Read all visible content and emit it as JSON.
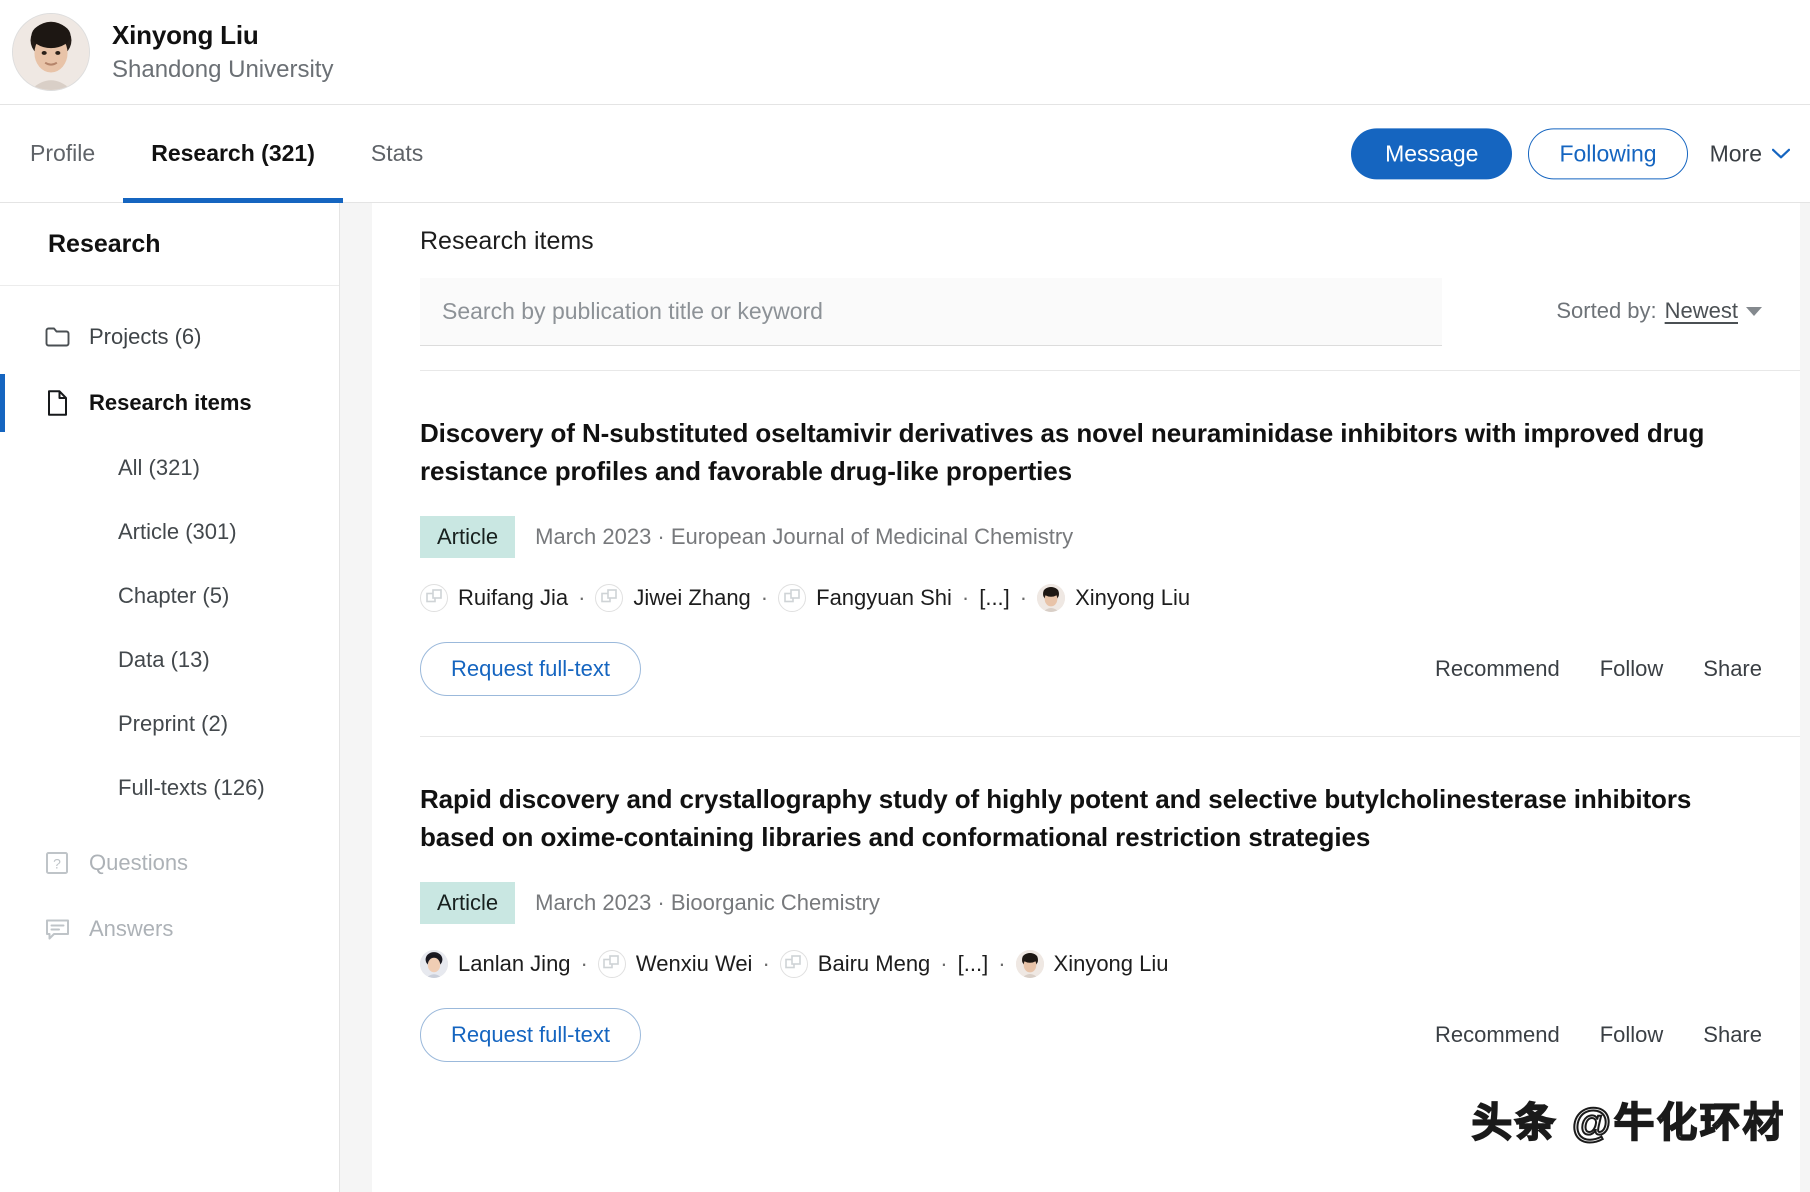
{
  "profile": {
    "name": "Xinyong Liu",
    "affiliation": "Shandong University",
    "avatar_icon": "user-photo"
  },
  "tabs": [
    {
      "label": "Profile",
      "active": false
    },
    {
      "label": "Research (321)",
      "active": true
    },
    {
      "label": "Stats",
      "active": false
    }
  ],
  "header_actions": {
    "message_label": "Message",
    "following_label": "Following",
    "more_label": "More",
    "chevron_icon": "chevron-down-icon",
    "primary_color": "#1565c0"
  },
  "sidebar": {
    "title": "Research",
    "items": [
      {
        "label": "Projects (6)",
        "icon": "folder-icon",
        "active": false,
        "muted": false
      },
      {
        "label": "Research items",
        "icon": "document-icon",
        "active": true,
        "muted": false
      }
    ],
    "sub_items": [
      {
        "label": "All (321)"
      },
      {
        "label": "Article (301)"
      },
      {
        "label": "Chapter (5)"
      },
      {
        "label": "Data (13)"
      },
      {
        "label": "Preprint (2)"
      },
      {
        "label": "Full-texts (126)"
      }
    ],
    "footer_items": [
      {
        "label": "Questions",
        "icon": "question-box-icon",
        "muted": true
      },
      {
        "label": "Answers",
        "icon": "speech-bubble-icon",
        "muted": true
      }
    ]
  },
  "main": {
    "heading": "Research items",
    "search": {
      "placeholder": "Search by publication title or keyword",
      "value": ""
    },
    "sort": {
      "label": "Sorted by:",
      "value": "Newest",
      "caret_icon": "caret-down-icon"
    },
    "publications": [
      {
        "title": "Discovery of N-substituted oseltamivir derivatives as novel neuraminidase inhibitors with improved drug resistance profiles and favorable drug-like properties",
        "type": "Article",
        "source": "March 2023 · European Journal of Medicinal Chemistry",
        "authors": [
          {
            "name": "Ruifang Jia",
            "avatar": "placeholder"
          },
          {
            "name": "Jiwei Zhang",
            "avatar": "placeholder"
          },
          {
            "name": "Fangyuan Shi",
            "avatar": "placeholder"
          },
          {
            "name": "[...]",
            "avatar": "none"
          },
          {
            "name": "Xinyong Liu",
            "avatar": "photo"
          }
        ],
        "request_label": "Request full-text",
        "links": [
          "Recommend",
          "Follow",
          "Share"
        ]
      },
      {
        "title": "Rapid discovery and crystallography study of highly potent and selective butylcholinesterase inhibitors based on oxime-containing libraries and conformational restriction strategies",
        "type": "Article",
        "source": "March 2023 · Bioorganic Chemistry",
        "authors": [
          {
            "name": "Lanlan Jing",
            "avatar": "photo"
          },
          {
            "name": "Wenxiu Wei",
            "avatar": "placeholder"
          },
          {
            "name": "Bairu Meng",
            "avatar": "placeholder"
          },
          {
            "name": "[...]",
            "avatar": "none"
          },
          {
            "name": "Xinyong Liu",
            "avatar": "photo"
          }
        ],
        "request_label": "Request full-text",
        "links": [
          "Recommend",
          "Follow",
          "Share"
        ]
      }
    ]
  },
  "watermark": {
    "text": "头条 @牛化环材"
  }
}
